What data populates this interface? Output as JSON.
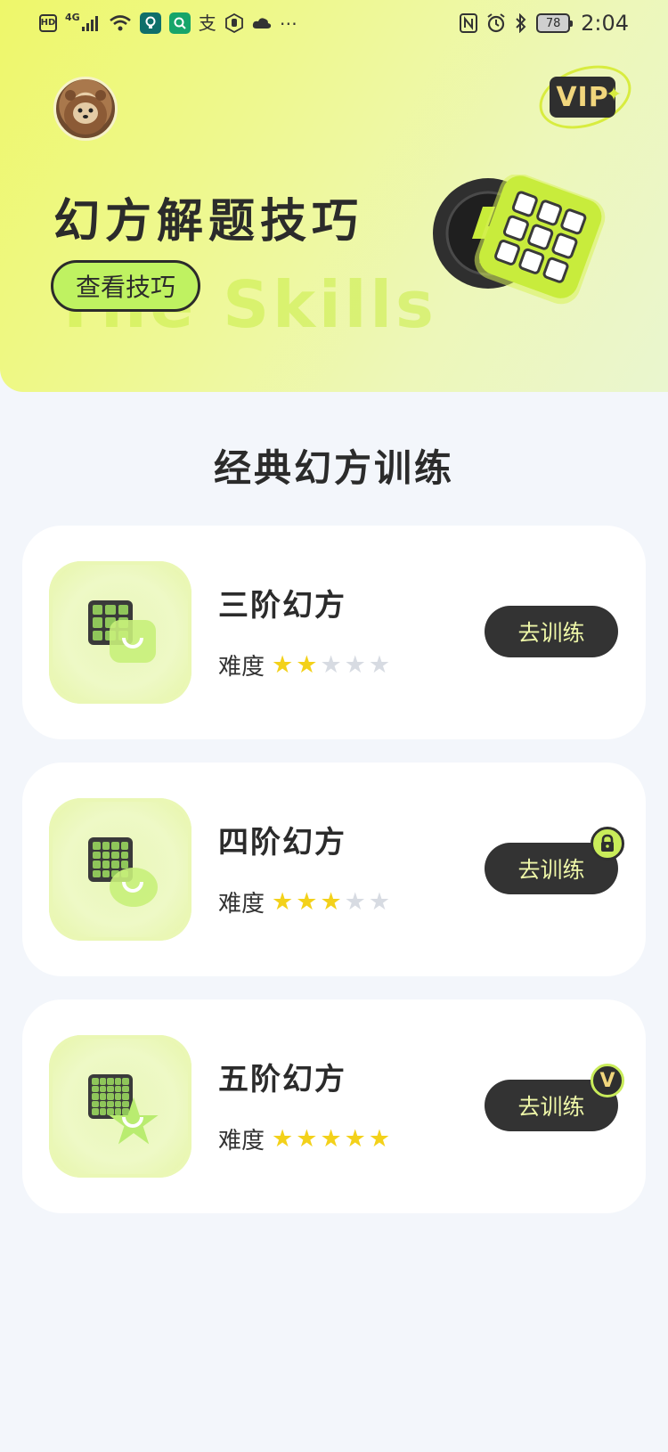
{
  "status_bar": {
    "left_icons": [
      "HD",
      "4G",
      "signal-icon",
      "wifi-icon",
      "app-icon-bulb",
      "app-icon-search",
      "支",
      "hand-icon",
      "cloud-icon",
      "more-icon"
    ],
    "battery": "78",
    "time": "2:04"
  },
  "header": {
    "title": "幻方解题技巧",
    "watermark": "The Skills",
    "button_label": "查看技巧",
    "vip_label": "VIP"
  },
  "section": {
    "title": "经典幻方训练"
  },
  "difficulty_label": "难度",
  "max_stars": 5,
  "courses": [
    {
      "name": "三阶幻方",
      "difficulty": 2,
      "button": "去训练",
      "badge": "",
      "icon": "grid-3-bubble-icon"
    },
    {
      "name": "四阶幻方",
      "difficulty": 3,
      "button": "去训练",
      "badge": "lock",
      "icon": "grid-4-chat-icon"
    },
    {
      "name": "五阶幻方",
      "difficulty": 5,
      "button": "去训练",
      "badge": "V",
      "icon": "grid-5-star-icon"
    }
  ],
  "colors": {
    "accent": "#c9ec5a",
    "dark": "#333333",
    "star_on": "#f3d11a",
    "star_off": "#d7dbe2"
  }
}
